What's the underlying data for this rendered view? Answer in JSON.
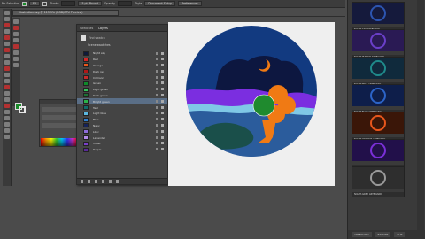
{
  "topbar": {
    "left_label": "No Selection",
    "btn_left": "Fill",
    "btn_stroke_label": "Stroke",
    "brush_label": "5 pt. Round",
    "opacity_label": "Opacity",
    "style_label": "Style",
    "doc_setup": "Document Setup",
    "preferences": "Preferences"
  },
  "document": {
    "tab_title": "illustration.svg @ 113.9% (RGB/GPU Preview)"
  },
  "panel": {
    "tabs": [
      "Swatches",
      "Layers"
    ],
    "active_tab": 0,
    "search_placeholder": "Find swatch",
    "group_label": "Scene swatches",
    "swatches": [
      {
        "name": "Night sky",
        "color": "#0f1a3a"
      },
      {
        "name": "Red",
        "color": "#d32626"
      },
      {
        "name": "Orange",
        "color": "#e8561c"
      },
      {
        "name": "Dark red",
        "color": "#b01818"
      },
      {
        "name": "Crimson",
        "color": "#c62a2a"
      },
      {
        "name": "Green",
        "color": "#0f8a2a"
      },
      {
        "name": "Light green",
        "color": "#33c35a"
      },
      {
        "name": "Dark green",
        "color": "#1c6f34"
      },
      {
        "name": "Bright green",
        "color": "#2ab34a"
      },
      {
        "name": "Teal",
        "color": "#116a6a"
      },
      {
        "name": "Light blue",
        "color": "#5bb7df"
      },
      {
        "name": "Blue",
        "color": "#2f7fd0"
      },
      {
        "name": "Navy",
        "color": "#15225a"
      },
      {
        "name": "Lilac",
        "color": "#8c6bd8"
      },
      {
        "name": "Lavender",
        "color": "#b28ae8"
      },
      {
        "name": "Violet",
        "color": "#7a3fc8"
      },
      {
        "name": "Purple",
        "color": "#5a2a9a"
      }
    ]
  },
  "artwork": {
    "colors": {
      "circle_bg": "#123a80",
      "sky": "#0d1740",
      "moon": "#f07a14",
      "purple": "#7b2ee0",
      "light_blue": "#7fc8e6",
      "water": "#2b5c9c",
      "teal": "#1a4f4a",
      "tree_green": "#1f8a2e",
      "tree_orange": "#f07a14"
    }
  },
  "right_panel": {
    "cards": [
      {
        "label": "NIGHT SKY ARTBOARD",
        "bg": "#151a3c",
        "accent": "#2c55b0"
      },
      {
        "label": "NIGHT-PURPLE ARTBOARD",
        "bg": "#2a1a54",
        "accent": "#6a3fc8"
      },
      {
        "label": "NIGHT-TEAL ARTBOARD",
        "bg": "#102a3c",
        "accent": "#1f8a8a"
      },
      {
        "label": "NIGHT-BLUE ARTBOARD",
        "bg": "#0e1e4a",
        "accent": "#2c64c8"
      },
      {
        "label": "NIGHT-ORANGE ARTBOARD",
        "bg": "#3a1608",
        "accent": "#e8561c"
      },
      {
        "label": "NIGHT-VIOLET ARTBOARD",
        "bg": "#22104a",
        "accent": "#7a2fd8"
      },
      {
        "label": "NIGHT-GREY ARTBOARD",
        "bg": "#2e2e2e",
        "accent": "#9a9a9a"
      }
    ],
    "bottom_buttons": [
      "ARTBOARD",
      "EXPORT",
      "CUT"
    ]
  }
}
